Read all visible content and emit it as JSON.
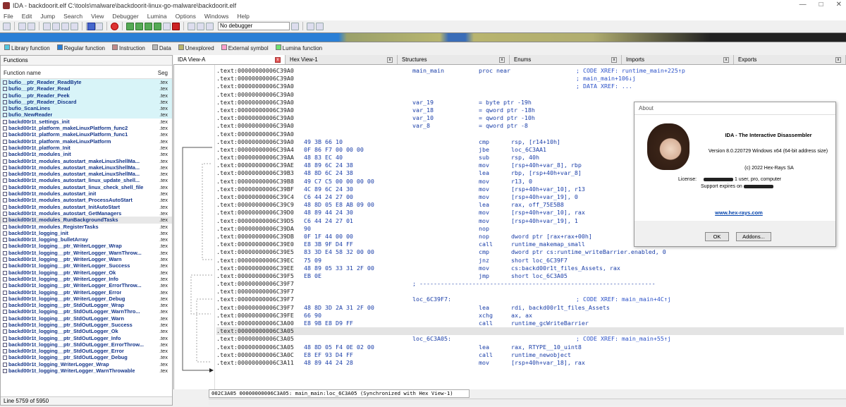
{
  "window": {
    "title": "IDA - backdoorit.elf C:\\tools\\malware\\backdoorit-linux-go-malware\\backdoorit.elf"
  },
  "menu": [
    "File",
    "Edit",
    "Jump",
    "Search",
    "View",
    "Debugger",
    "Lumina",
    "Options",
    "Windows",
    "Help"
  ],
  "toolbar": {
    "debugger_select": "No debugger"
  },
  "legend": [
    {
      "label": "Library function",
      "color": "#54c8e0"
    },
    {
      "label": "Regular function",
      "color": "#2a7fd6"
    },
    {
      "label": "Instruction",
      "color": "#c08a8a"
    },
    {
      "label": "Data",
      "color": "#b8b8b8"
    },
    {
      "label": "Unexplored",
      "color": "#b8b46e"
    },
    {
      "label": "External symbol",
      "color": "#ff9ecc"
    },
    {
      "label": "Lumina function",
      "color": "#6ee06e"
    }
  ],
  "functions_panel": {
    "title": "Functions",
    "col_name": "Function name",
    "col_seg": "Seg",
    "status": "Line 5759 of 5950",
    "rows": [
      {
        "name": "bufio__ptr_Reader_ReadByte",
        "seg": ".tex",
        "lib": true
      },
      {
        "name": "bufio__ptr_Reader_Read",
        "seg": ".tex",
        "lib": true
      },
      {
        "name": "bufio__ptr_Reader_Peek",
        "seg": ".tex",
        "lib": true
      },
      {
        "name": "bufio__ptr_Reader_Discard",
        "seg": ".tex",
        "lib": true
      },
      {
        "name": "bufio_ScanLines",
        "seg": ".tex",
        "lib": true
      },
      {
        "name": "bufio_NewReader",
        "seg": ".tex",
        "lib": true
      },
      {
        "name": "backd00r1t_settings_init",
        "seg": ".tex"
      },
      {
        "name": "backd00r1t_platform_makeLinuxPlatform_func2",
        "seg": ".tex"
      },
      {
        "name": "backd00r1t_platform_makeLinuxPlatform_func1",
        "seg": ".tex"
      },
      {
        "name": "backd00r1t_platform_makeLinuxPlatform",
        "seg": ".tex"
      },
      {
        "name": "backd00r1t_platform_Init",
        "seg": ".tex"
      },
      {
        "name": "backd00r1t_modules_init",
        "seg": ".tex"
      },
      {
        "name": "backd00r1t_modules_autostart_makeLinuxShellMa...",
        "seg": ".tex"
      },
      {
        "name": "backd00r1t_modules_autostart_makeLinuxShellMa...",
        "seg": ".tex"
      },
      {
        "name": "backd00r1t_modules_autostart_makeLinuxShellMa...",
        "seg": ".tex"
      },
      {
        "name": "backd00r1t_modules_autostart_linux_update_shell...",
        "seg": ".tex"
      },
      {
        "name": "backd00r1t_modules_autostart_linux_check_shell_file",
        "seg": ".tex"
      },
      {
        "name": "backd00r1t_modules_autostart_init",
        "seg": ".tex"
      },
      {
        "name": "backd00r1t_modules_autostart_ProcessAutoStart",
        "seg": ".tex"
      },
      {
        "name": "backd00r1t_modules_autostart_InitAutoStart",
        "seg": ".tex"
      },
      {
        "name": "backd00r1t_modules_autostart_GetManagers",
        "seg": ".tex"
      },
      {
        "name": "backd00r1t_modules_RunBackgroundTasks",
        "seg": ".tex",
        "sel": true
      },
      {
        "name": "backd00r1t_modules_RegisterTasks",
        "seg": ".tex"
      },
      {
        "name": "backd00r1t_logging_init",
        "seg": ".tex"
      },
      {
        "name": "backd00r1t_logging_bulletArray",
        "seg": ".tex"
      },
      {
        "name": "backd00r1t_logging__ptr_WriterLogger_Wrap",
        "seg": ".tex"
      },
      {
        "name": "backd00r1t_logging__ptr_WriterLogger_WarnThrow...",
        "seg": ".tex"
      },
      {
        "name": "backd00r1t_logging__ptr_WriterLogger_Warn",
        "seg": ".tex"
      },
      {
        "name": "backd00r1t_logging__ptr_WriterLogger_Success",
        "seg": ".tex"
      },
      {
        "name": "backd00r1t_logging__ptr_WriterLogger_Ok",
        "seg": ".tex"
      },
      {
        "name": "backd00r1t_logging__ptr_WriterLogger_Info",
        "seg": ".tex"
      },
      {
        "name": "backd00r1t_logging__ptr_WriterLogger_ErrorThrow...",
        "seg": ".tex"
      },
      {
        "name": "backd00r1t_logging__ptr_WriterLogger_Error",
        "seg": ".tex"
      },
      {
        "name": "backd00r1t_logging__ptr_WriterLogger_Debug",
        "seg": ".tex"
      },
      {
        "name": "backd00r1t_logging__ptr_StdOutLogger_Wrap",
        "seg": ".tex"
      },
      {
        "name": "backd00r1t_logging__ptr_StdOutLogger_WarnThro...",
        "seg": ".tex"
      },
      {
        "name": "backd00r1t_logging__ptr_StdOutLogger_Warn",
        "seg": ".tex"
      },
      {
        "name": "backd00r1t_logging__ptr_StdOutLogger_Success",
        "seg": ".tex"
      },
      {
        "name": "backd00r1t_logging__ptr_StdOutLogger_Ok",
        "seg": ".tex"
      },
      {
        "name": "backd00r1t_logging__ptr_StdOutLogger_Info",
        "seg": ".tex"
      },
      {
        "name": "backd00r1t_logging__ptr_StdOutLogger_ErrorThrow...",
        "seg": ".tex"
      },
      {
        "name": "backd00r1t_logging__ptr_StdOutLogger_Error",
        "seg": ".tex"
      },
      {
        "name": "backd00r1t_logging__ptr_StdOutLogger_Debug",
        "seg": ".tex"
      },
      {
        "name": "backd00r1t_logging_WriterLogger_Wrap",
        "seg": ".tex"
      },
      {
        "name": "backd00r1t_logging_WriterLogger_WarnThrowable",
        "seg": ".tex"
      }
    ]
  },
  "tabs": [
    {
      "label": "IDA View-A",
      "active": true
    },
    {
      "label": "Hex View-1"
    },
    {
      "label": "Structures"
    },
    {
      "label": "Enums"
    },
    {
      "label": "Imports"
    },
    {
      "label": "Exports"
    }
  ],
  "code": [
    {
      "a": ".text:00000000006C39A0",
      "l": "main_main",
      "m": "proc near",
      "c": "; CODE XREF: runtime_main+225↑p"
    },
    {
      "a": ".text:00000000006C39A0",
      "c": "; main_main+106↓j"
    },
    {
      "a": ".text:00000000006C39A0",
      "c": "; DATA XREF: ..."
    },
    {
      "a": ".text:00000000006C39A0"
    },
    {
      "a": ".text:00000000006C39A0",
      "l": "var_19",
      "m": "= byte ptr -19h"
    },
    {
      "a": ".text:00000000006C39A0",
      "l": "var_18",
      "m": "= qword ptr -18h"
    },
    {
      "a": ".text:00000000006C39A0",
      "l": "var_10",
      "m": "= qword ptr -10h"
    },
    {
      "a": ".text:00000000006C39A0",
      "l": "var_8",
      "m": "= qword ptr -8"
    },
    {
      "a": ".text:00000000006C39A0"
    },
    {
      "a": ".text:00000000006C39A0",
      "b": "49 3B 66 10",
      "m": "cmp",
      "o": "rsp, [r14+10h]"
    },
    {
      "a": ".text:00000000006C39A4",
      "b": "0F 86 F7 00 00 00",
      "m": "jbe",
      "o": "loc_6C3AA1"
    },
    {
      "a": ".text:00000000006C39AA",
      "b": "48 83 EC 40",
      "m": "sub",
      "o": "rsp, 40h"
    },
    {
      "a": ".text:00000000006C39AE",
      "b": "48 89 6C 24 38",
      "m": "mov",
      "o": "[rsp+40h+var_8], rbp"
    },
    {
      "a": ".text:00000000006C39B3",
      "b": "48 8D 6C 24 38",
      "m": "lea",
      "o": "rbp, [rsp+40h+var_8]"
    },
    {
      "a": ".text:00000000006C39B8",
      "b": "49 C7 C5 00 00 00 00",
      "m": "mov",
      "o": "r13, 0"
    },
    {
      "a": ".text:00000000006C39BF",
      "b": "4C 89 6C 24 30",
      "m": "mov",
      "o": "[rsp+40h+var_10], r13"
    },
    {
      "a": ".text:00000000006C39C4",
      "b": "C6 44 24 27 00",
      "m": "mov",
      "o": "[rsp+40h+var_19], 0"
    },
    {
      "a": ".text:00000000006C39C9",
      "b": "48 8D 05 E8 AB 09 00",
      "m": "lea",
      "o": "rax, off_75E5B8"
    },
    {
      "a": ".text:00000000006C39D0",
      "b": "48 89 44 24 30",
      "m": "mov",
      "o": "[rsp+40h+var_10], rax"
    },
    {
      "a": ".text:00000000006C39D5",
      "b": "C6 44 24 27 01",
      "m": "mov",
      "o": "[rsp+40h+var_19], 1"
    },
    {
      "a": ".text:00000000006C39DA",
      "b": "90",
      "m": "nop"
    },
    {
      "a": ".text:00000000006C39DB",
      "b": "0F 1F 44 00 00",
      "m": "nop",
      "o": "dword ptr [rax+rax+00h]"
    },
    {
      "a": ".text:00000000006C39E0",
      "b": "E8 3B 9F D4 FF",
      "m": "call",
      "o": "runtime_makemap_small"
    },
    {
      "a": ".text:00000000006C39E5",
      "b": "83 3D E4 58 32 00 00",
      "m": "cmp",
      "o": "dword ptr cs:runtime_writeBarrier.enabled, 0"
    },
    {
      "a": ".text:00000000006C39EC",
      "b": "75 09",
      "m": "jnz",
      "o": "short loc_6C39F7"
    },
    {
      "a": ".text:00000000006C39EE",
      "b": "48 89 05 33 31 2F 00",
      "m": "mov",
      "o": "cs:backd00r1t_files_Assets, rax"
    },
    {
      "a": ".text:00000000006C39F5",
      "b": "EB 0E",
      "m": "jmp",
      "o": "short loc_6C3A05"
    },
    {
      "a": ".text:00000000006C39F7",
      "l": "; -------------------------------------------------------------------"
    },
    {
      "a": ".text:00000000006C39F7"
    },
    {
      "a": ".text:00000000006C39F7",
      "l": "loc_6C39F7:",
      "c": "; CODE XREF: main_main+4C↑j"
    },
    {
      "a": ".text:00000000006C39F7",
      "b": "48 8D 3D 2A 31 2F 00",
      "m": "lea",
      "o": "rdi, backd00r1t_files_Assets"
    },
    {
      "a": ".text:00000000006C39FE",
      "b": "66 90",
      "m": "xchg",
      "o": "ax, ax"
    },
    {
      "a": ".text:00000000006C3A00",
      "b": "E8 9B E8 D9 FF",
      "m": "call",
      "o": "runtime_gcWriteBarrier"
    },
    {
      "a": ".text:00000000006C3A05",
      "sel": true
    },
    {
      "a": ".text:00000000006C3A05",
      "l": "loc_6C3A05:",
      "c": "; CODE XREF: main_main+55↑j"
    },
    {
      "a": ".text:00000000006C3A05",
      "b": "48 8D 05 F4 0E 02 00",
      "m": "lea",
      "o": "rax, RTYPE__10_uint8"
    },
    {
      "a": ".text:00000000006C3A0C",
      "b": "E8 EF 93 D4 FF",
      "m": "call",
      "o": "runtime_newobject"
    },
    {
      "a": ".text:00000000006C3A11",
      "b": "48 89 44 24 28",
      "m": "mov",
      "o": "[rsp+40h+var_18], rax"
    }
  ],
  "status_line": "002C3A05 00000000006C3A05: main_main:loc_6C3A05 (Synchronized with Hex View-1)",
  "about": {
    "title": "About",
    "product": "IDA - The Interactive Disassembler",
    "version": "Version 8.0.220729 Windows x64 (64-bit address size)",
    "copyright": "(c) 2022 Hex-Rays SA",
    "license_label": "License:",
    "license_value": "1 user, pro, computer",
    "support": "Support expires on",
    "link": "www.hex-rays.com",
    "ok": "OK",
    "addons": "Addons..."
  }
}
